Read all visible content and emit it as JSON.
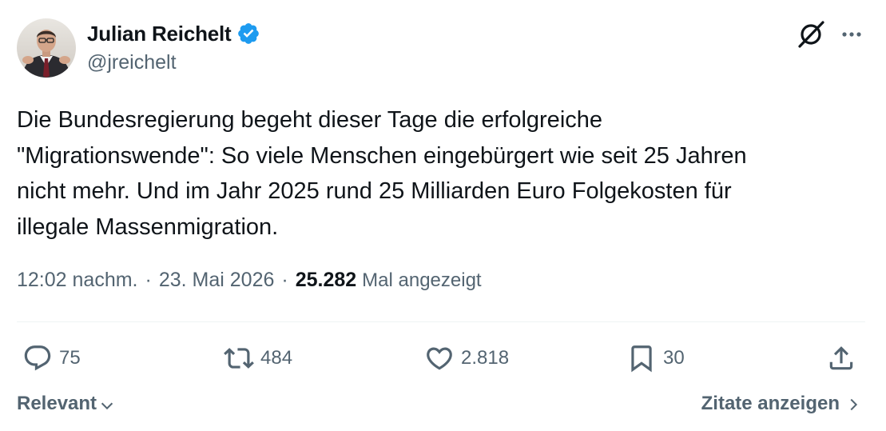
{
  "author": {
    "display_name": "Julian Reichelt",
    "handle": "@jreichelt",
    "verified": true
  },
  "tweet": {
    "text": "Die Bundesregierung begeht dieser Tage die erfolgreiche\n\"Migrationswende\": So viele Menschen eingebürgert wie seit 25 Jahren\nnicht mehr. Und im Jahr 2025 rund 25 Milliarden Euro Folgekosten für\nillegale Massenmigration."
  },
  "meta": {
    "time": "12:02 nachm.",
    "separator": "·",
    "date": "23. Mai 2026",
    "views_count": "25.282",
    "views_label": "Mal angezeigt"
  },
  "actions": {
    "replies": "75",
    "reposts": "484",
    "likes": "2.818",
    "bookmarks": "30"
  },
  "footer": {
    "sort_label": "Relevant",
    "quotes_label": "Zitate anzeigen"
  },
  "colors": {
    "text_primary": "#0f1419",
    "text_secondary": "#536471",
    "verified_blue": "#1d9bf0",
    "divider": "#eff3f4"
  },
  "icons": {
    "verified": "verified-badge-icon",
    "grok": "grok-icon",
    "more": "more-icon",
    "reply": "reply-icon",
    "repost": "repost-icon",
    "like": "heart-icon",
    "bookmark": "bookmark-icon",
    "share": "share-icon",
    "chevron_down": "chevron-down-icon",
    "chevron_right": "chevron-right-icon"
  }
}
